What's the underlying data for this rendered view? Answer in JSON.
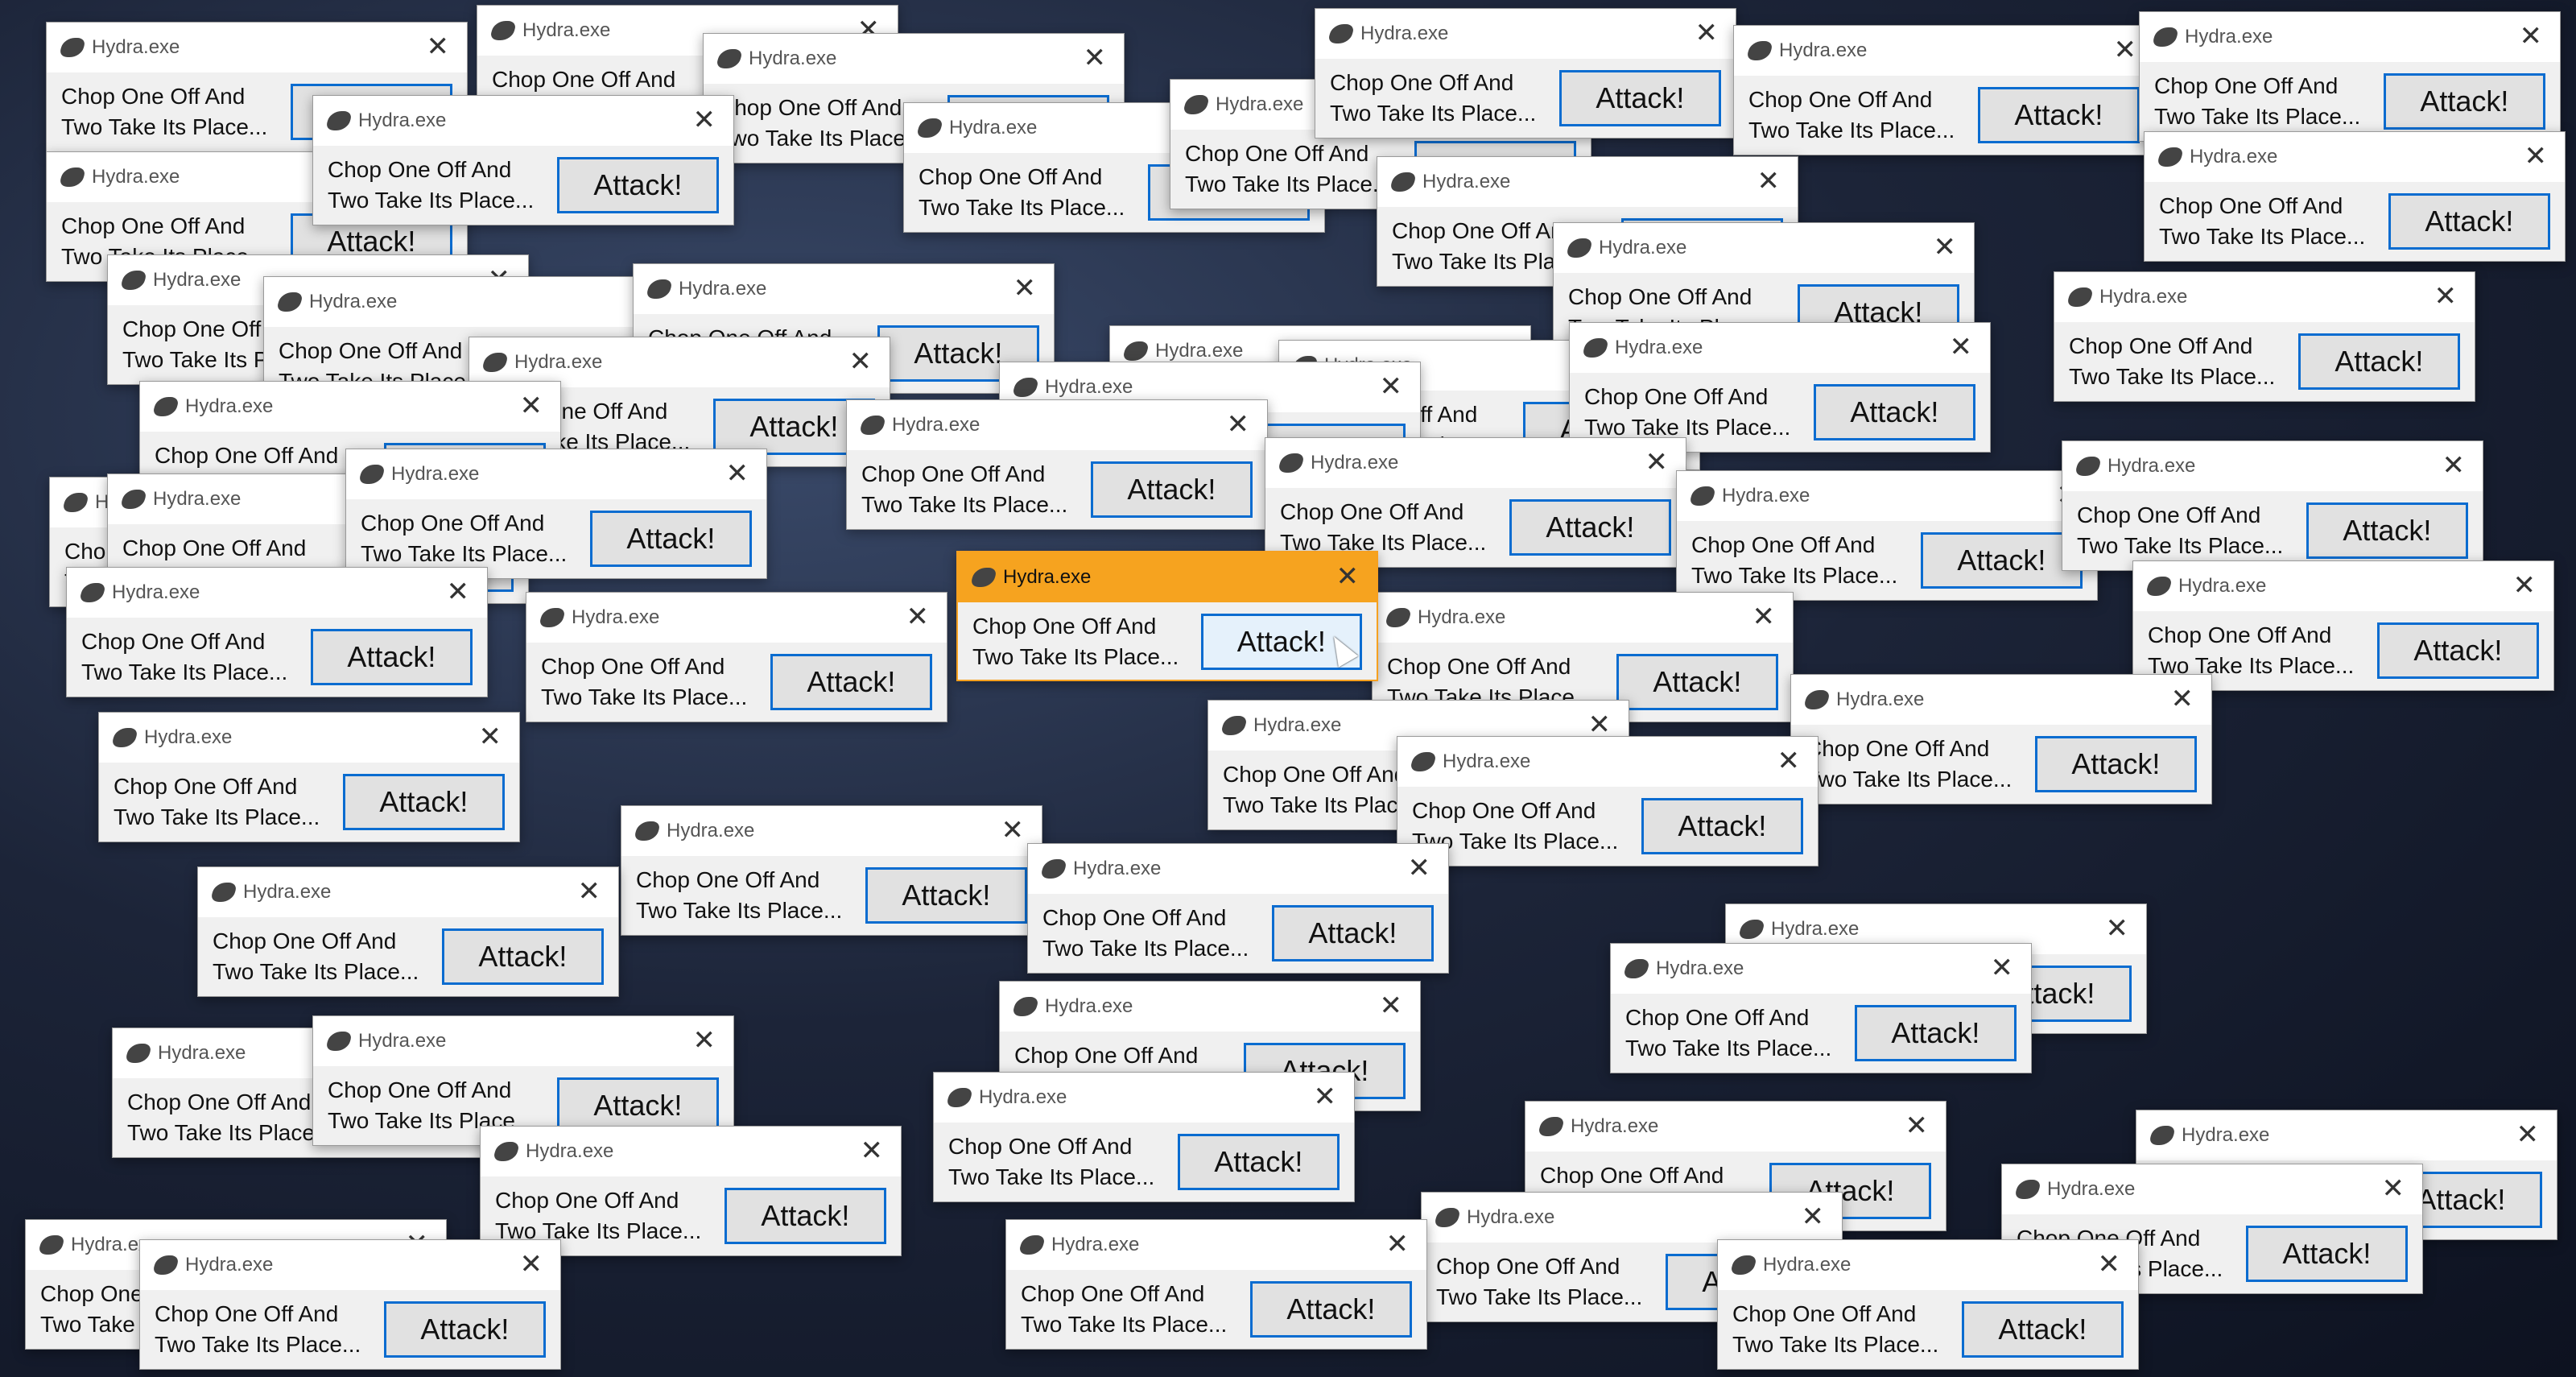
{
  "dialog": {
    "title": "Hydra.exe",
    "message": "Chop One Off And Two Take Its Place...",
    "button_label": "Attack!",
    "close_glyph": "✕"
  },
  "active_title_color": "#f6a31f",
  "button_border_color": "#0a6cd0"
}
